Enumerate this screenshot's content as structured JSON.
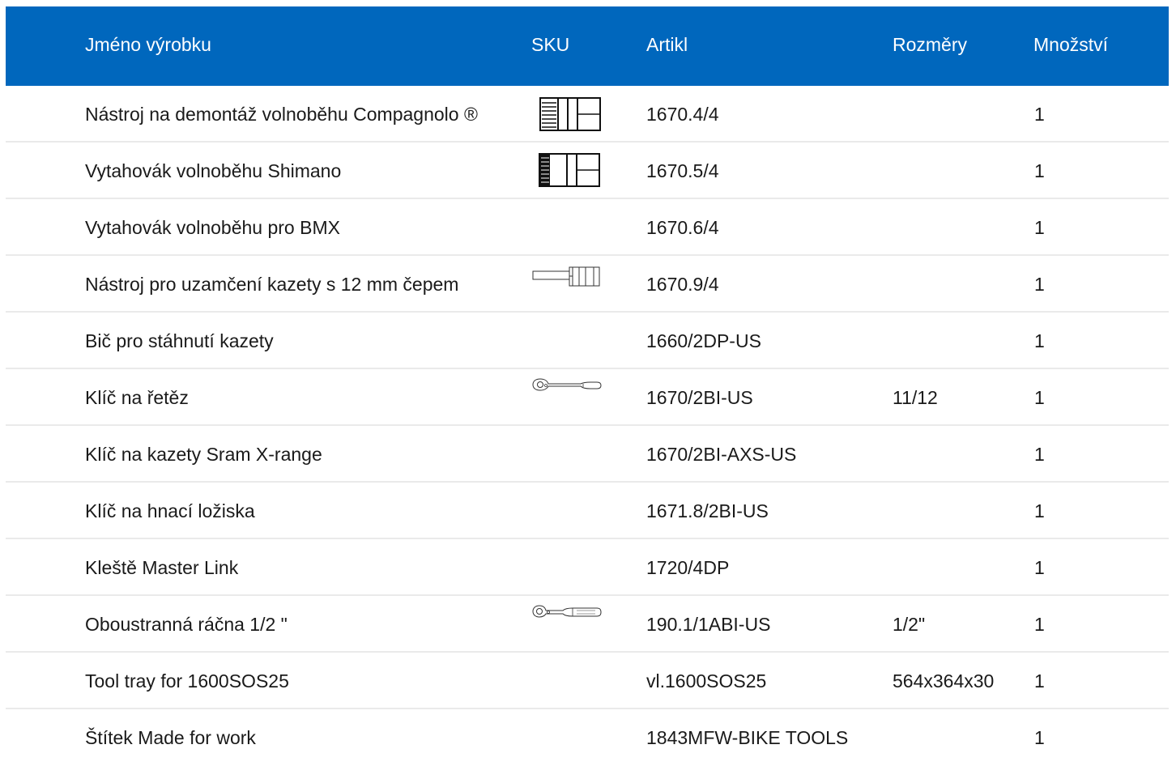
{
  "header": {
    "name": "Jméno výrobku",
    "sku": "SKU",
    "article": "Artikl",
    "dimensions": "Rozměry",
    "quantity": "Množství"
  },
  "rows": [
    {
      "name": "Nástroj na demontáž volnoběhu Compagnolo ®",
      "article": "1670.4/4",
      "dimensions": "",
      "quantity": "1",
      "image": "freewheel-tool-icon"
    },
    {
      "name": "Vytahovák volnoběhu Shimano",
      "article": "1670.5/4",
      "dimensions": "",
      "quantity": "1",
      "image": "freewheel-tool-icon"
    },
    {
      "name": "Vytahovák volnoběhu pro BMX",
      "article": "1670.6/4",
      "dimensions": "",
      "quantity": "1",
      "image": ""
    },
    {
      "name": "Nástroj pro uzamčení kazety s 12 mm čepem",
      "article": "1670.9/4",
      "dimensions": "",
      "quantity": "1",
      "image": "cassette-lockring-tool-icon"
    },
    {
      "name": "Bič pro stáhnutí kazety",
      "article": "1660/2DP-US",
      "dimensions": "",
      "quantity": "1",
      "image": ""
    },
    {
      "name": "Klíč na řetěz",
      "article": "1670/2BI-US",
      "dimensions": "11/12",
      "quantity": "1",
      "image": "wrench-icon"
    },
    {
      "name": "Klíč na kazety Sram X-range",
      "article": "1670/2BI-AXS-US",
      "dimensions": "",
      "quantity": "1",
      "image": ""
    },
    {
      "name": "Klíč na hnací ložiska",
      "article": "1671.8/2BI-US",
      "dimensions": "",
      "quantity": "1",
      "image": ""
    },
    {
      "name": "Kleště Master Link",
      "article": "1720/4DP",
      "dimensions": "",
      "quantity": "1",
      "image": ""
    },
    {
      "name": "Oboustranná ráčna 1/2 \"",
      "article": "190.1/1ABI-US",
      "dimensions": "1/2\"",
      "quantity": "1",
      "image": "ratchet-icon"
    },
    {
      "name": "Tool tray for 1600SOS25",
      "article": "vl.1600SOS25",
      "dimensions": "564x364x30",
      "quantity": "1",
      "image": ""
    },
    {
      "name": "Štítek Made for work",
      "article": "1843MFW-BIKE TOOLS",
      "dimensions": "",
      "quantity": "1",
      "image": ""
    }
  ],
  "colors": {
    "header_bg": "#0067bd",
    "header_text": "#ffffff",
    "row_divider": "#eaeaea",
    "body_text": "#1a1a1a"
  }
}
